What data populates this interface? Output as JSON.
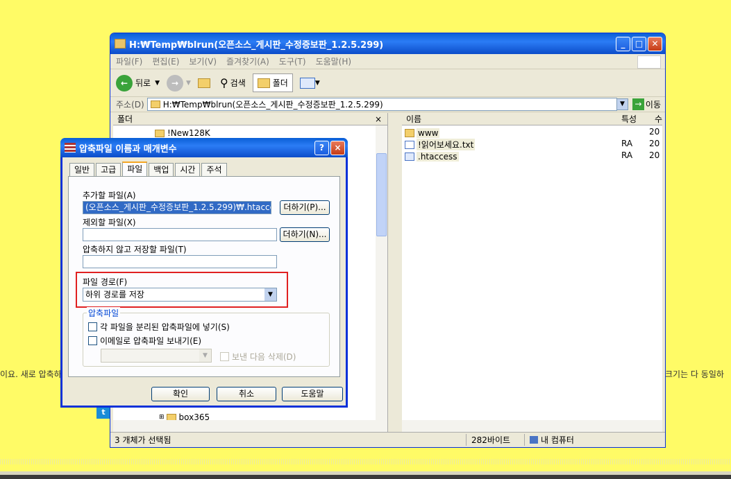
{
  "background": {
    "left_text": "이요. 새로 압축하",
    "right_text": "크기는 다 동일하",
    "twitter_icon": "twitter-icon"
  },
  "explorer": {
    "title": "H:₩Temp₩blrun(오픈소스_게시판_수정증보판_1.2.5.299)",
    "menu": [
      "파일(F)",
      "편집(E)",
      "보기(V)",
      "즐겨찾기(A)",
      "도구(T)",
      "도움말(H)"
    ],
    "toolbar": {
      "back": "뒤로",
      "search": "검색",
      "folders": "폴더"
    },
    "address_label": "주소(D)",
    "address_value": "H:₩Temp₩blrun(오픈소스_게시판_수정증보판_1.2.5.299)",
    "go_label": "이동",
    "folders_header": "폴더",
    "folders_close": "×",
    "tree_items": [
      "!New128K",
      "box365"
    ],
    "columns": {
      "name": "이름",
      "attr": "특성",
      "extra": "수"
    },
    "files": [
      {
        "name": "www",
        "attr": "",
        "extra": "20"
      },
      {
        "name": "!읽어보세요.txt",
        "attr": "RA",
        "extra": "20"
      },
      {
        "name": ".htaccess",
        "attr": "RA",
        "extra": "20"
      }
    ],
    "status": {
      "selection": "3 개체가 선택됨",
      "size": "282바이트",
      "location": "내 컴퓨터"
    }
  },
  "dialog": {
    "title": "압축파일 이름과 매개변수",
    "help_btn": "?",
    "close_btn": "×",
    "tabs": [
      "일반",
      "고급",
      "파일",
      "백업",
      "시간",
      "주석"
    ],
    "active_tab": "파일",
    "add_files_label": "추가할 파일(A)",
    "add_files_value": "(오픈소스_게시판_수정증보판_1.2.5.299)₩.htaccess",
    "add_btn": "더하기(P)...",
    "exclude_label": "제외할 파일(X)",
    "exclude_value": "",
    "exclude_btn": "더하기(N)...",
    "store_label": "압축하지 않고 저장할 파일(T)",
    "store_value": "",
    "path_label": "파일 경로(F)",
    "path_value": "하위 경로를 저장",
    "archive_group": "압축파일",
    "separate_archive": "각 파일을 분리된 압축파일에 넣기(S)",
    "email_archive": "이메일로 압축파일 보내기(E)",
    "delete_after": "보낸 다음 삭제(D)",
    "ok": "확인",
    "cancel": "취소",
    "help": "도움말"
  }
}
